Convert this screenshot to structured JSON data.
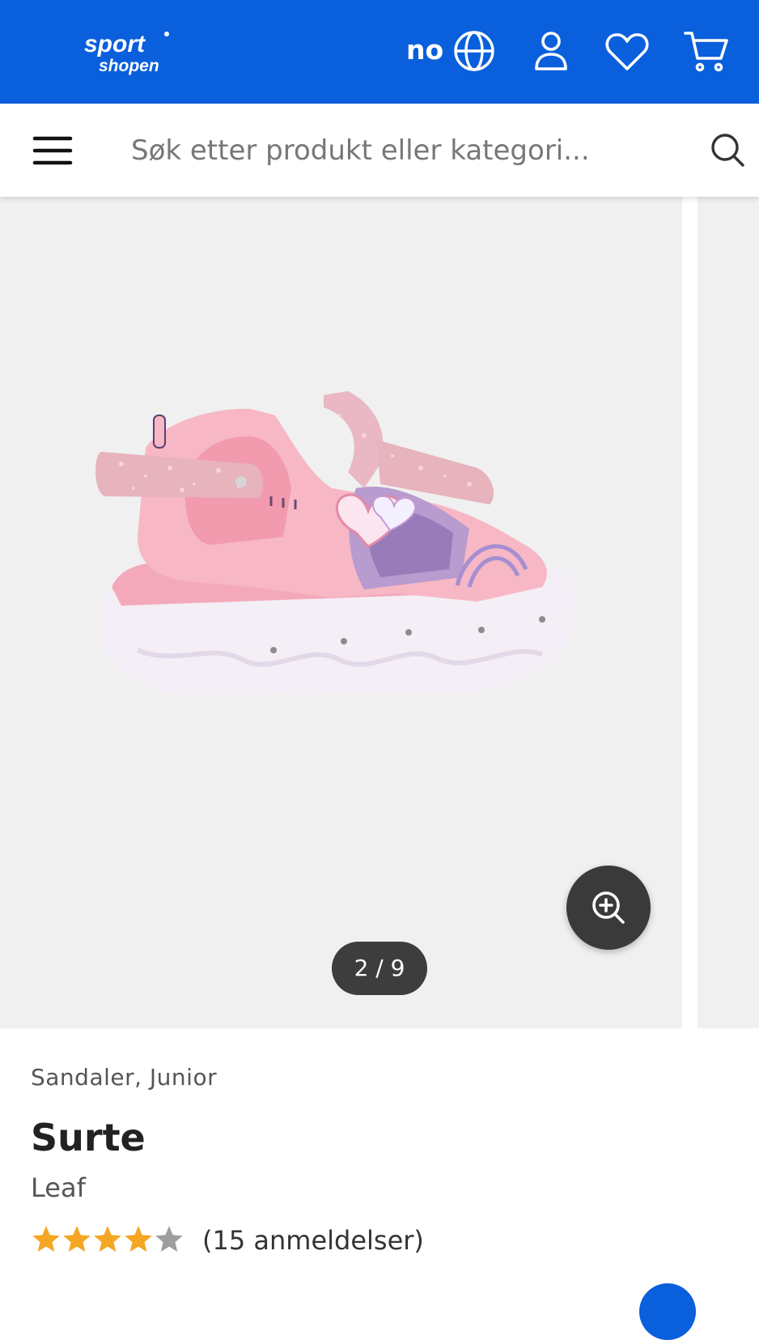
{
  "header": {
    "logo_text": "sport shopen",
    "language_label": "no",
    "background_color": "#0a5fdc",
    "icons": [
      "globe-icon",
      "user-icon",
      "heart-icon",
      "cart-icon"
    ]
  },
  "search": {
    "placeholder": "Søk etter produkt eller kategori...",
    "menu_icon": "hamburger-icon",
    "search_icon": "search-icon"
  },
  "gallery": {
    "counter": "2 / 9",
    "zoom_icon": "zoom-in-icon",
    "image_description": "Pink glitter sandal with light-up sole"
  },
  "product": {
    "category": "Sandaler, Junior",
    "title": "Surte",
    "brand": "Leaf",
    "rating_value": 4.5,
    "rating_max": 5,
    "reviews_label": "(15 anmeldelser)",
    "star_color": "#f5a623"
  }
}
